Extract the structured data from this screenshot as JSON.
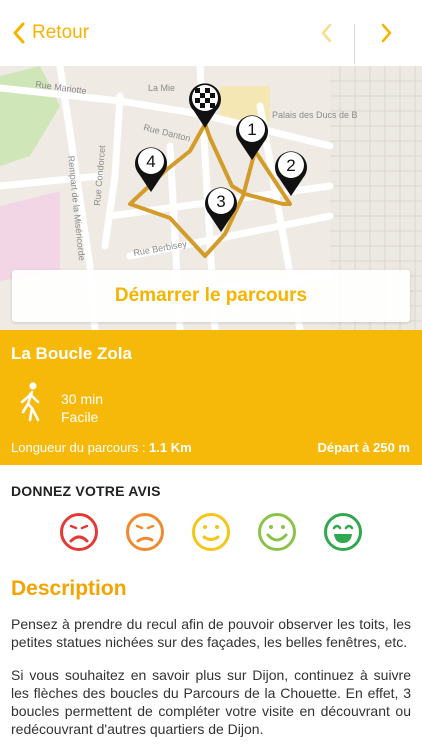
{
  "header": {
    "back_label": "Retour"
  },
  "map": {
    "street_labels": [
      "Rue Mariotte",
      "Rue Danton",
      "Rue Condorcet",
      "Rempart de la Miséricorde",
      "Rue Berbisey",
      "La Mie",
      "Palais des Ducs de B"
    ],
    "markers": [
      "1",
      "2",
      "3",
      "4"
    ],
    "route_color": "#d39b2a"
  },
  "start_button": {
    "label": "Démarrer le parcours"
  },
  "tour": {
    "name": "La Boucle Zola",
    "duration": "30 min",
    "difficulty": "Facile",
    "length_label": "Longueur du parcours : ",
    "length_value": "1.1 Km",
    "departure": "Départ à 250 m"
  },
  "feedback": {
    "title": "DONNEZ VOTRE AVIS",
    "colors": [
      "#e53935",
      "#f08a30",
      "#f5c518",
      "#8bc34a",
      "#2fa84f"
    ]
  },
  "description": {
    "title": "Description",
    "p1": "Pensez à prendre du recul afin de pouvoir observer les toits, les petites statues nichées sur des façades, les belles fenêtres, etc.",
    "p2": "Si vous souhaitez en savoir plus sur Dijon, continuez à suivre les flèches des boucles du Parcours de la Chouette. En effet, 3 boucles permettent de compléter votre visite en découvrant ou redécouvrant d'autres quartiers de Dijon."
  },
  "colors": {
    "accent": "#f5b400",
    "panel": "#f6b90a"
  }
}
